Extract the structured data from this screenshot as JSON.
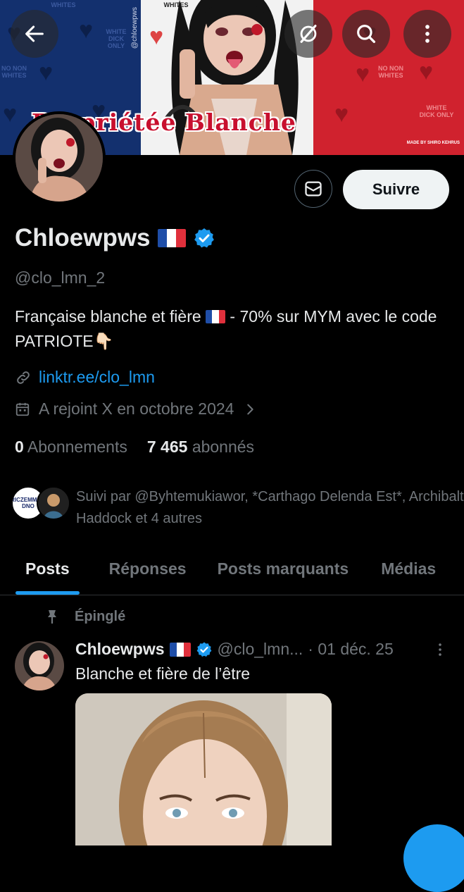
{
  "banner": {
    "title": "Propriétée Blanche",
    "vertical_handle": "@chloewpws",
    "mini_texts": [
      "WHITES",
      "NO NON WHITES",
      "WHITE DICK ONLY"
    ],
    "made_by": "MADE BY SHIRO KEHRUS",
    "colors": {
      "blue": "#13306e",
      "white": "#f2f2f2",
      "red": "#d0222e",
      "title": "#c8102e"
    }
  },
  "top_bar": {
    "back_icon": "arrow-left-icon",
    "grok_icon": "grok-slash-icon",
    "search_icon": "search-icon",
    "more_icon": "more-vertical-icon"
  },
  "profile": {
    "display_name": "Chloewpws",
    "flag_icon": "france-flag-icon",
    "verified_icon": "verified-badge-icon",
    "handle": "@clo_lmn_2",
    "bio_part1": "Française blanche et fière",
    "bio_part2": " - 70% sur MYM avec le code PATRIOTE👇🏻",
    "link": "linktr.ee/clo_lmn",
    "joined": "A rejoint X en octobre 2024",
    "following_count": "0",
    "following_label": "Abonnements",
    "followers_count": "7 465",
    "followers_label": "abonnés",
    "followed_by": "Suivi par @Byhtemukiawor, *Carthago Delenda Est*, Archibalt Haddock et 4 autres",
    "mini_avatar_text": "ÉRICZEMMOUR DNO"
  },
  "actions": {
    "message_icon": "mail-icon",
    "follow_label": "Suivre"
  },
  "tabs": [
    {
      "label": "Posts",
      "active": true
    },
    {
      "label": "Réponses",
      "active": false
    },
    {
      "label": "Posts marquants",
      "active": false
    },
    {
      "label": "Médias",
      "active": false
    }
  ],
  "post": {
    "pinned_label": "Épinglé",
    "author": "Chloewpws",
    "handle": "@clo_lmn...",
    "date": "· 01 déc. 25",
    "text": "Blanche et fière de l’être"
  },
  "colors": {
    "accent": "#1d9bf0",
    "text": "#e7e9ea",
    "muted": "#71767b",
    "border": "#2f3336",
    "background": "#000000"
  }
}
